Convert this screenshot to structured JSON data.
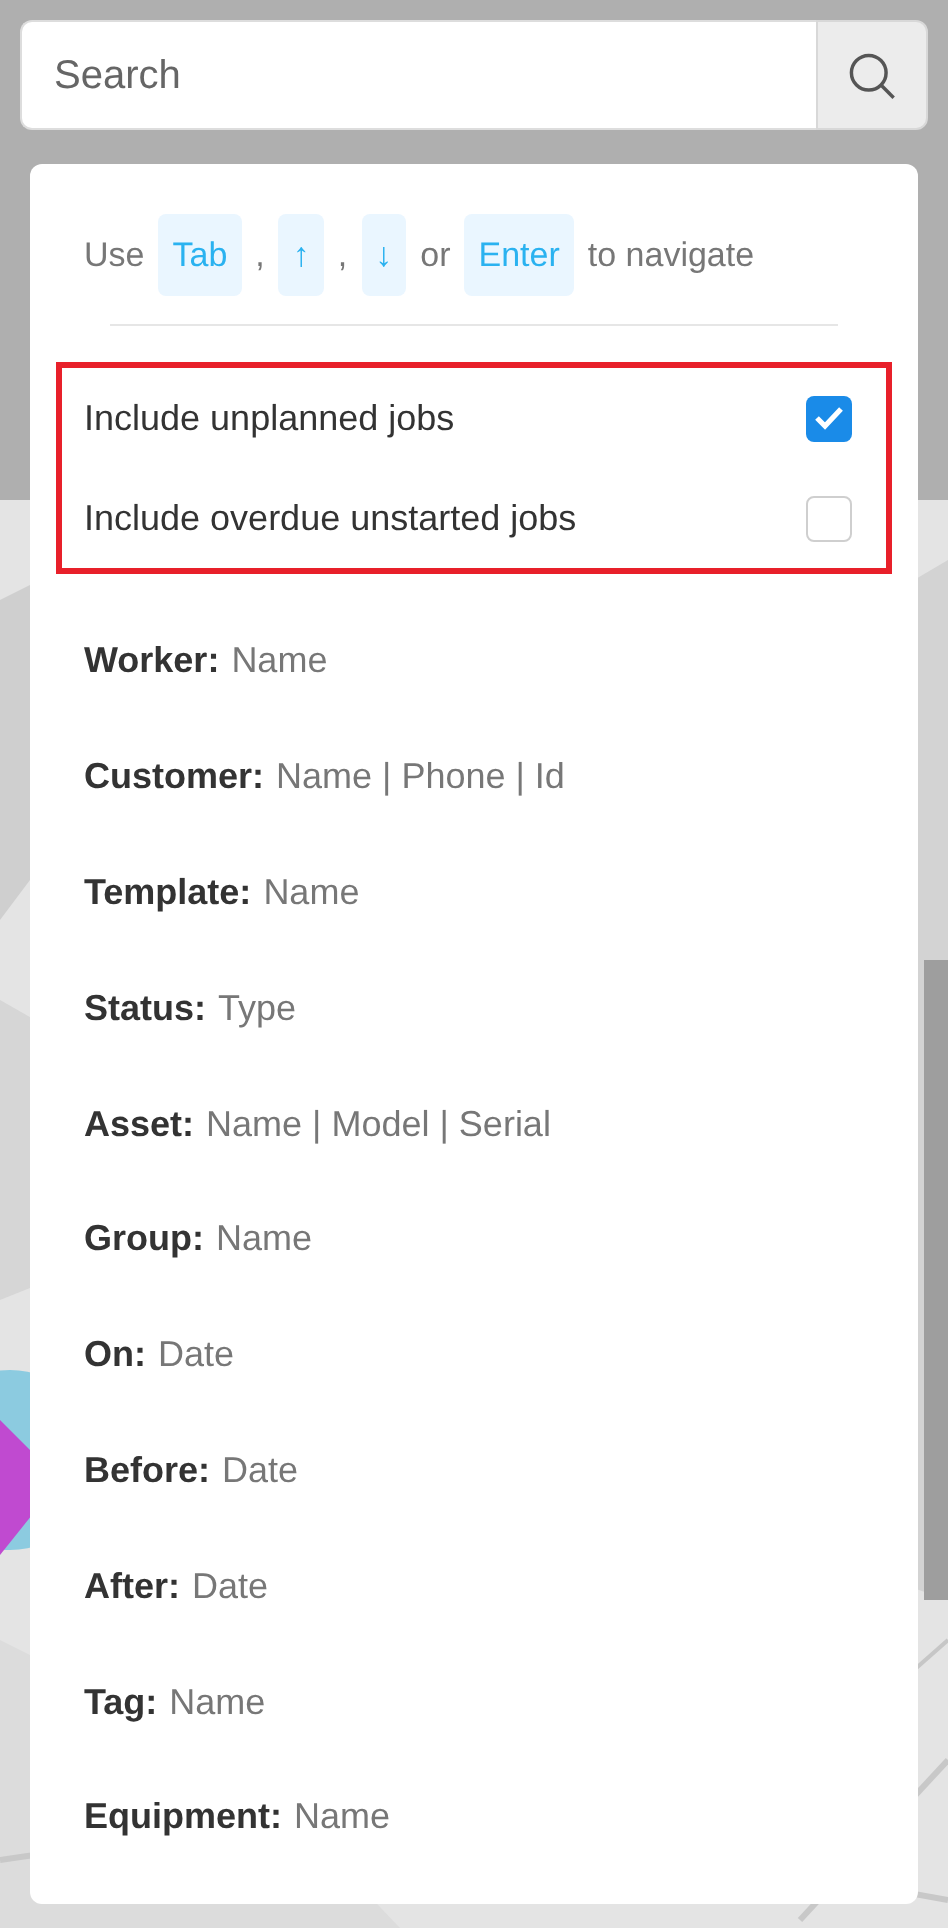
{
  "search": {
    "placeholder": "Search"
  },
  "hint": [
    {
      "kind": "text",
      "text": "Use"
    },
    {
      "kind": "key",
      "text": "Tab"
    },
    {
      "kind": "text",
      "text": ","
    },
    {
      "kind": "key",
      "text": "↑"
    },
    {
      "kind": "text",
      "text": ","
    },
    {
      "kind": "key",
      "text": "↓"
    },
    {
      "kind": "text",
      "text": "or"
    },
    {
      "kind": "key",
      "text": "Enter"
    },
    {
      "kind": "text",
      "text": "to navigate"
    }
  ],
  "options": [
    {
      "label": "Include unplanned jobs",
      "checked": true
    },
    {
      "label": "Include overdue unstarted jobs",
      "checked": false
    }
  ],
  "filters": [
    {
      "key": "Worker:",
      "hint": "Name"
    },
    {
      "key": "Customer:",
      "hint": "Name | Phone | Id"
    },
    {
      "key": "Template:",
      "hint": "Name"
    },
    {
      "key": "Status:",
      "hint": "Type"
    },
    {
      "key": "Asset:",
      "hint": "Name | Model | Serial"
    },
    {
      "key": "Group:",
      "hint": "Name"
    },
    {
      "key": "On:",
      "hint": "Date"
    },
    {
      "key": "Before:",
      "hint": "Date"
    },
    {
      "key": "After:",
      "hint": "Date"
    },
    {
      "key": "Tag:",
      "hint": "Name"
    },
    {
      "key": "Equipment:",
      "hint": "Name"
    }
  ]
}
